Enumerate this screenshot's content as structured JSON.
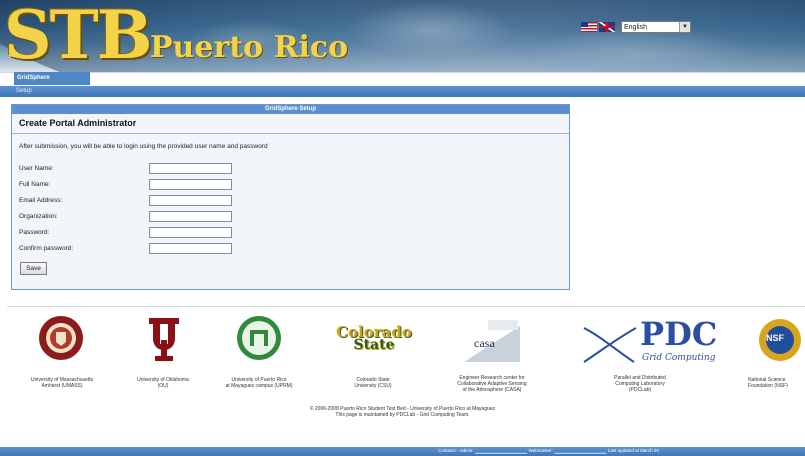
{
  "header": {
    "logo_main": "STB",
    "logo_sub": "Puerto Rico",
    "language": "English"
  },
  "tabs": [
    {
      "label": "GridSphere"
    }
  ],
  "subtabs": [
    {
      "label": "Setup"
    }
  ],
  "setup": {
    "panel_title": "GridSphere Setup",
    "heading": "Create Portal Administrator",
    "description": "After submission, you will be able to login using the provided user name and password",
    "fields": [
      {
        "label": "User Name:",
        "value": ""
      },
      {
        "label": "Full Name:",
        "value": ""
      },
      {
        "label": "Email Address:",
        "value": ""
      },
      {
        "label": "Organization:",
        "value": ""
      },
      {
        "label": "Password:",
        "value": ""
      },
      {
        "label": "Confirm password:",
        "value": ""
      }
    ],
    "save_label": "Save"
  },
  "partners": [
    {
      "caption_1": "University of Massachusetts",
      "caption_2": "Amherst (UMASS)"
    },
    {
      "caption_1": "University of Oklahoma",
      "caption_2": "(OU)"
    },
    {
      "caption_1": "University of Puerto Rico",
      "caption_2": "at Mayaguez campus (UPRM)"
    },
    {
      "caption_1": "Colorado State",
      "caption_2": "University (CSU)",
      "logo_text_1": "Colorado",
      "logo_text_2": "State"
    },
    {
      "caption_1": "Engineer Research center for",
      "caption_2": "Collaborative Adaptive Sensing",
      "caption_3": "of the Atmosphere (CASA)",
      "logo_text": "casa"
    },
    {
      "caption_1": "Parallel and Distributed",
      "caption_2": "Computing Laboratory",
      "caption_3": "(PDCLab)",
      "logo_text_1": "PDC",
      "logo_text_2": "Grid Computing"
    },
    {
      "caption_1": "National Science",
      "caption_2": "Foundation (NSF)",
      "logo_text": "NSF"
    }
  ],
  "footer": {
    "copyright": "© 2006-2008 Puerto Rico Student Test Bed - University of Puerto Rico at Mayaguez",
    "maintained": "This page is maintained by PDCLab - Grid Computing Team.",
    "contacts_label": "Contacts - Admin:",
    "webmaster_label": "Webmaster:",
    "last_updated": "Last updated at March 20"
  },
  "colors": {
    "accent": "#4f86c6",
    "panel_border": "#6f95c7",
    "logo_gold": "#f2d34a"
  }
}
